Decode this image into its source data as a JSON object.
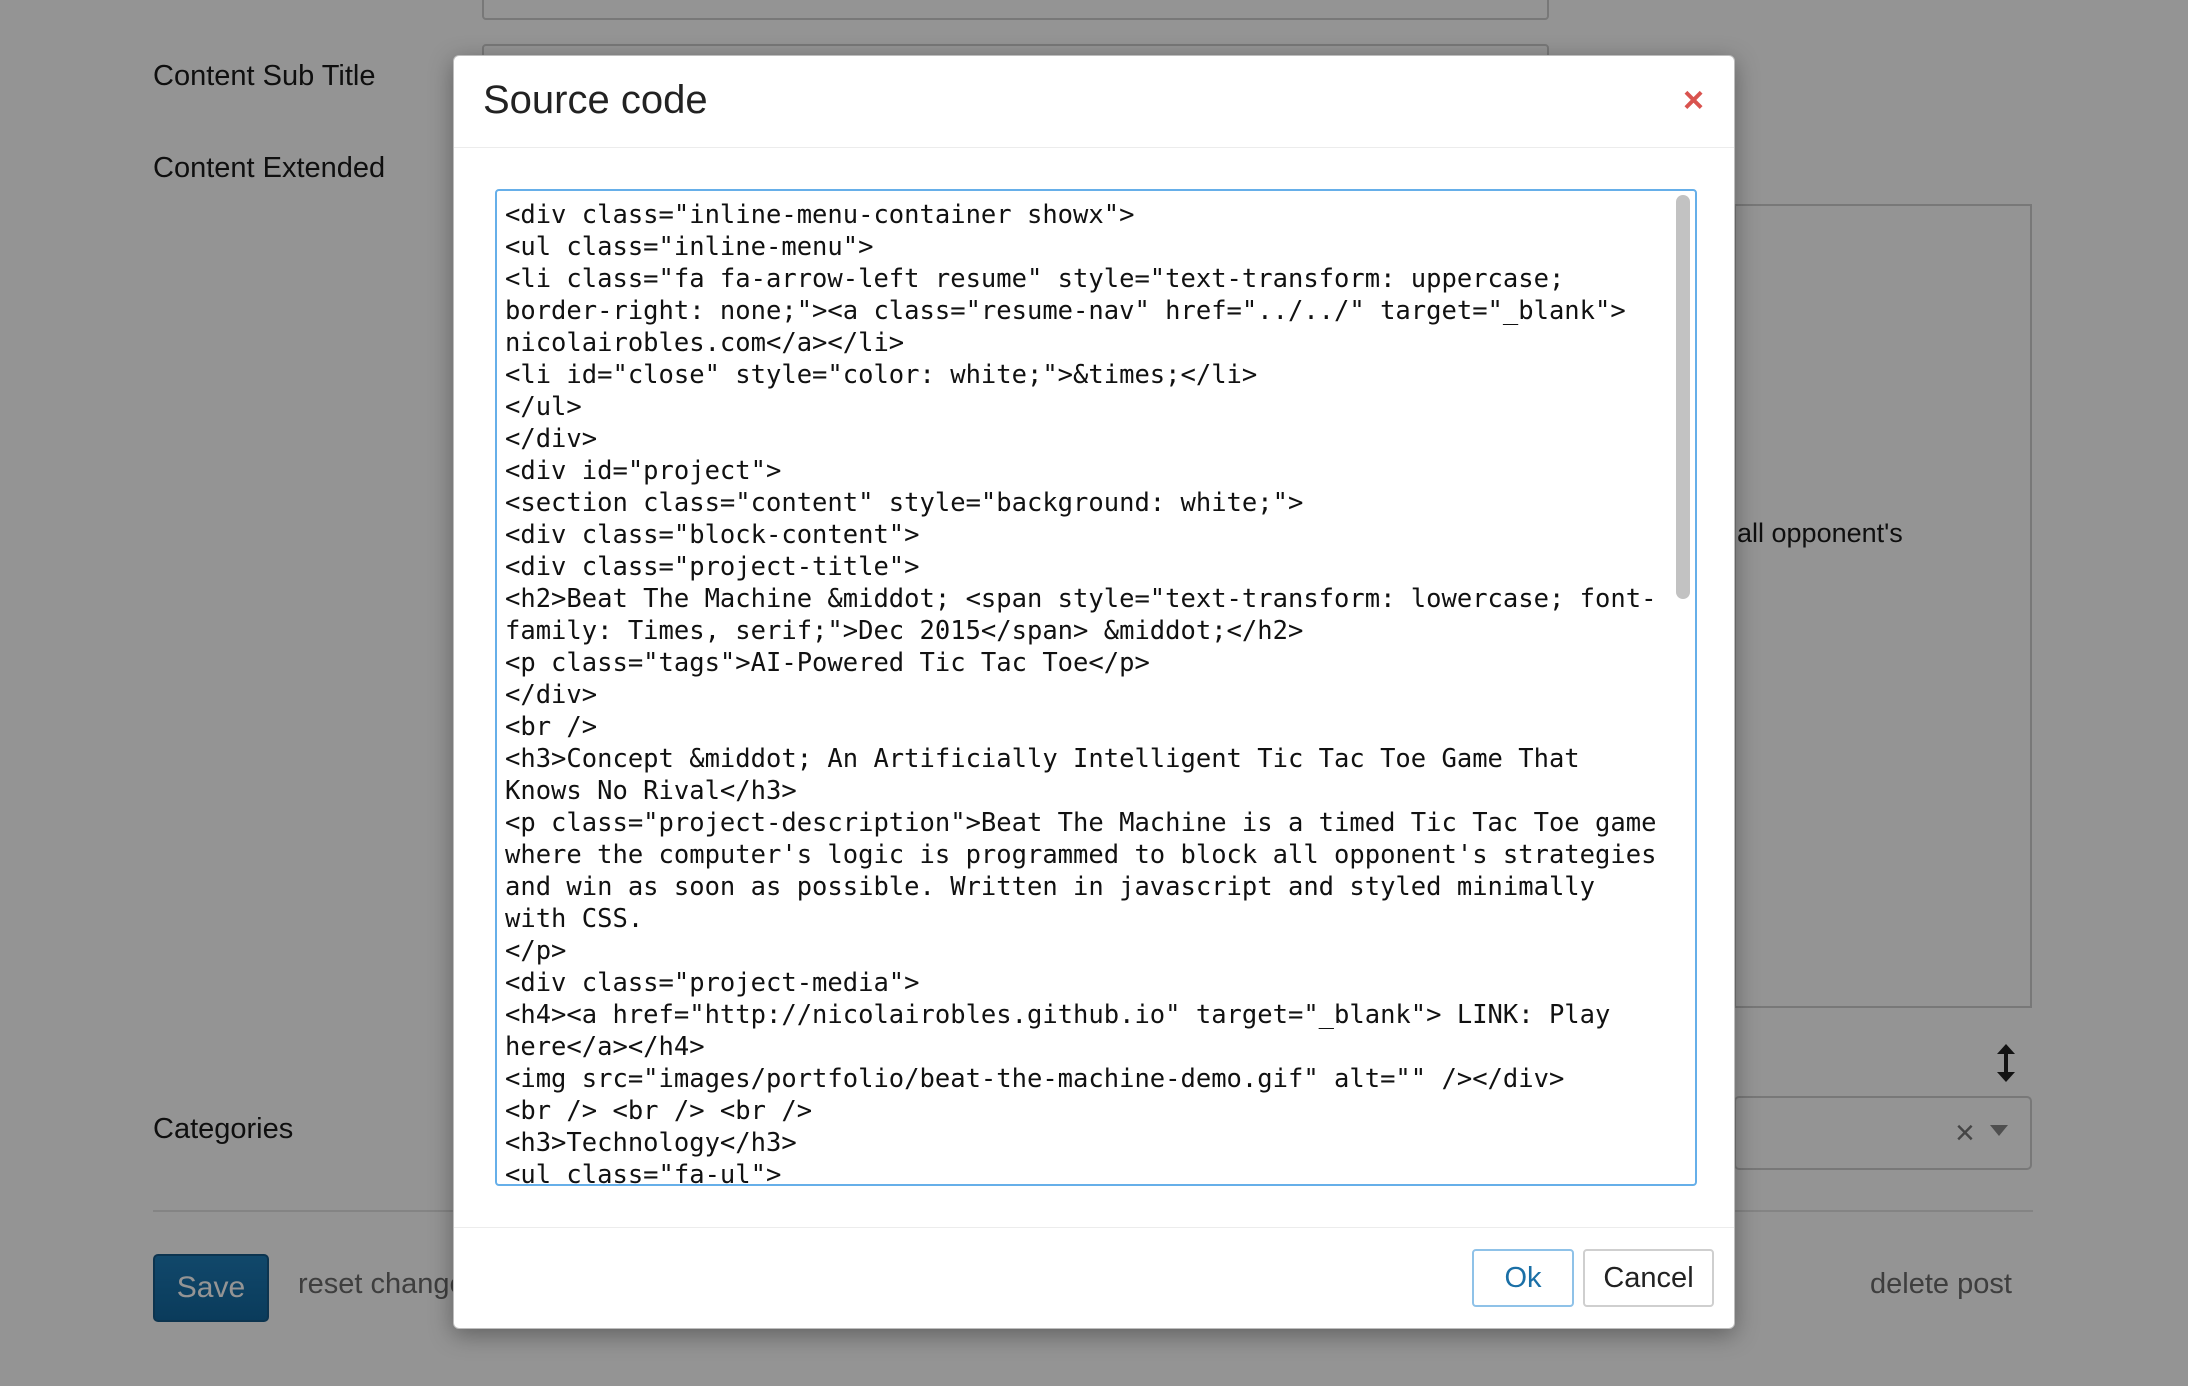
{
  "form": {
    "labels": {
      "content_sub_title": "Content Sub Title",
      "content_extended": "Content Extended",
      "categories": "Categories"
    },
    "editor_visible_text": "all opponent's",
    "save_label": "Save",
    "reset_label": "reset changes",
    "delete_label": "delete post",
    "select_clear_symbol": "×"
  },
  "modal": {
    "title": "Source code",
    "close_symbol": "×",
    "code": "<div class=\"inline-menu-container showx\">\n<ul class=\"inline-menu\">\n<li class=\"fa fa-arrow-left resume\" style=\"text-transform: uppercase; border-right: none;\"><a class=\"resume-nav\" href=\"../../\" target=\"_blank\">\nnicolairobles.com</a></li>\n<li id=\"close\" style=\"color: white;\">&times;</li>\n</ul>\n</div>\n<div id=\"project\">\n<section class=\"content\" style=\"background: white;\">\n<div class=\"block-content\">\n<div class=\"project-title\">\n<h2>Beat The Machine &middot; <span style=\"text-transform: lowercase; font-family: Times, serif;\">Dec 2015</span> &middot;</h2>\n<p class=\"tags\">AI-Powered Tic Tac Toe</p>\n</div>\n<br />\n<h3>Concept &middot; An Artificially Intelligent Tic Tac Toe Game That Knows No Rival</h3>\n<p class=\"project-description\">Beat The Machine is a timed Tic Tac Toe game where the computer's logic is programmed to block all opponent's strategies and win as soon as possible. Written in javascript and styled minimally with CSS.\n</p>\n<div class=\"project-media\">\n<h4><a href=\"http://nicolairobles.github.io\" target=\"_blank\"> LINK: Play here</a></h4>\n<img src=\"images/portfolio/beat-the-machine-demo.gif\" alt=\"\" /></div>\n<br /> <br /> <br />\n<h3>Technology</h3>\n<ul class=\"fa-ul\">\n<li>Javascript</li>\n<li>CSS</li>\n</ul>",
    "ok_label": "Ok",
    "cancel_label": "Cancel"
  },
  "colors": {
    "primary": "#1a6fa6",
    "close": "#d9534f",
    "focus_border": "#66afe9"
  }
}
